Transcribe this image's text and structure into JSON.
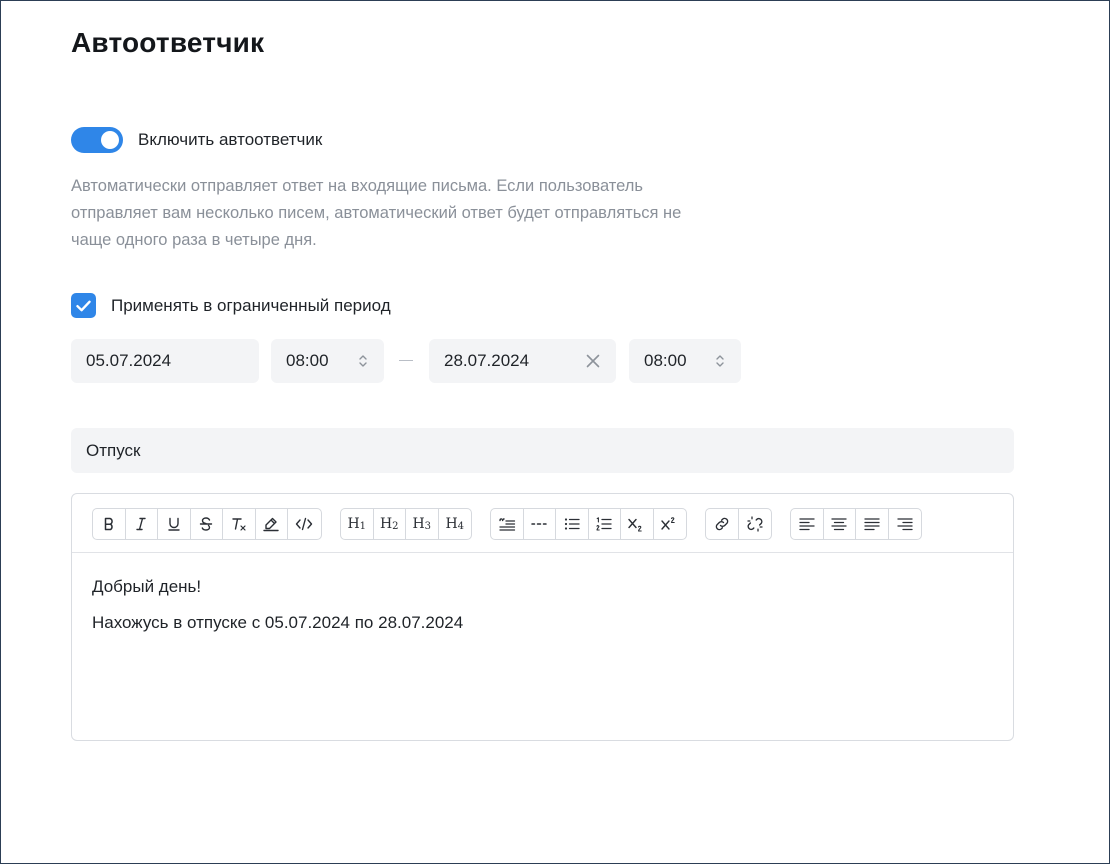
{
  "page": {
    "title": "Автоответчик"
  },
  "autoreply": {
    "toggle_label": "Включить автоответчик",
    "enabled": true,
    "description": "Автоматически отправляет ответ на входящие письма. Если пользователь отправляет вам несколько писем, автоматический ответ будет отправляться не чаще одного раза в четыре дня."
  },
  "period": {
    "checkbox_label": "Применять в ограниченный период",
    "checked": true,
    "start_date": "05.07.2024",
    "start_time": "08:00",
    "end_date": "28.07.2024",
    "end_time": "08:00"
  },
  "subject": {
    "value": "Отпуск"
  },
  "editor": {
    "toolbar_groups": [
      [
        "bold-icon",
        "italic-icon",
        "underline-icon",
        "strikethrough-icon",
        "clear-format-icon",
        "highlight-icon",
        "code-icon"
      ],
      [
        "heading-1-icon",
        "heading-2-icon",
        "heading-3-icon",
        "heading-4-icon"
      ],
      [
        "blockquote-icon",
        "horizontal-rule-icon",
        "bullet-list-icon",
        "ordered-list-icon",
        "subscript-icon",
        "superscript-icon"
      ],
      [
        "link-icon",
        "unlink-icon"
      ],
      [
        "align-left-icon",
        "align-center-icon",
        "align-justify-icon",
        "align-right-icon"
      ]
    ],
    "headings": [
      "1",
      "2",
      "3",
      "4"
    ],
    "lines": [
      "Добрый день!",
      "Нахожусь в отпуске с 05.07.2024 по 28.07.2024"
    ]
  },
  "colors": {
    "accent": "#2f86e8",
    "field_bg": "#f3f4f6",
    "muted_text": "#8a9099"
  }
}
